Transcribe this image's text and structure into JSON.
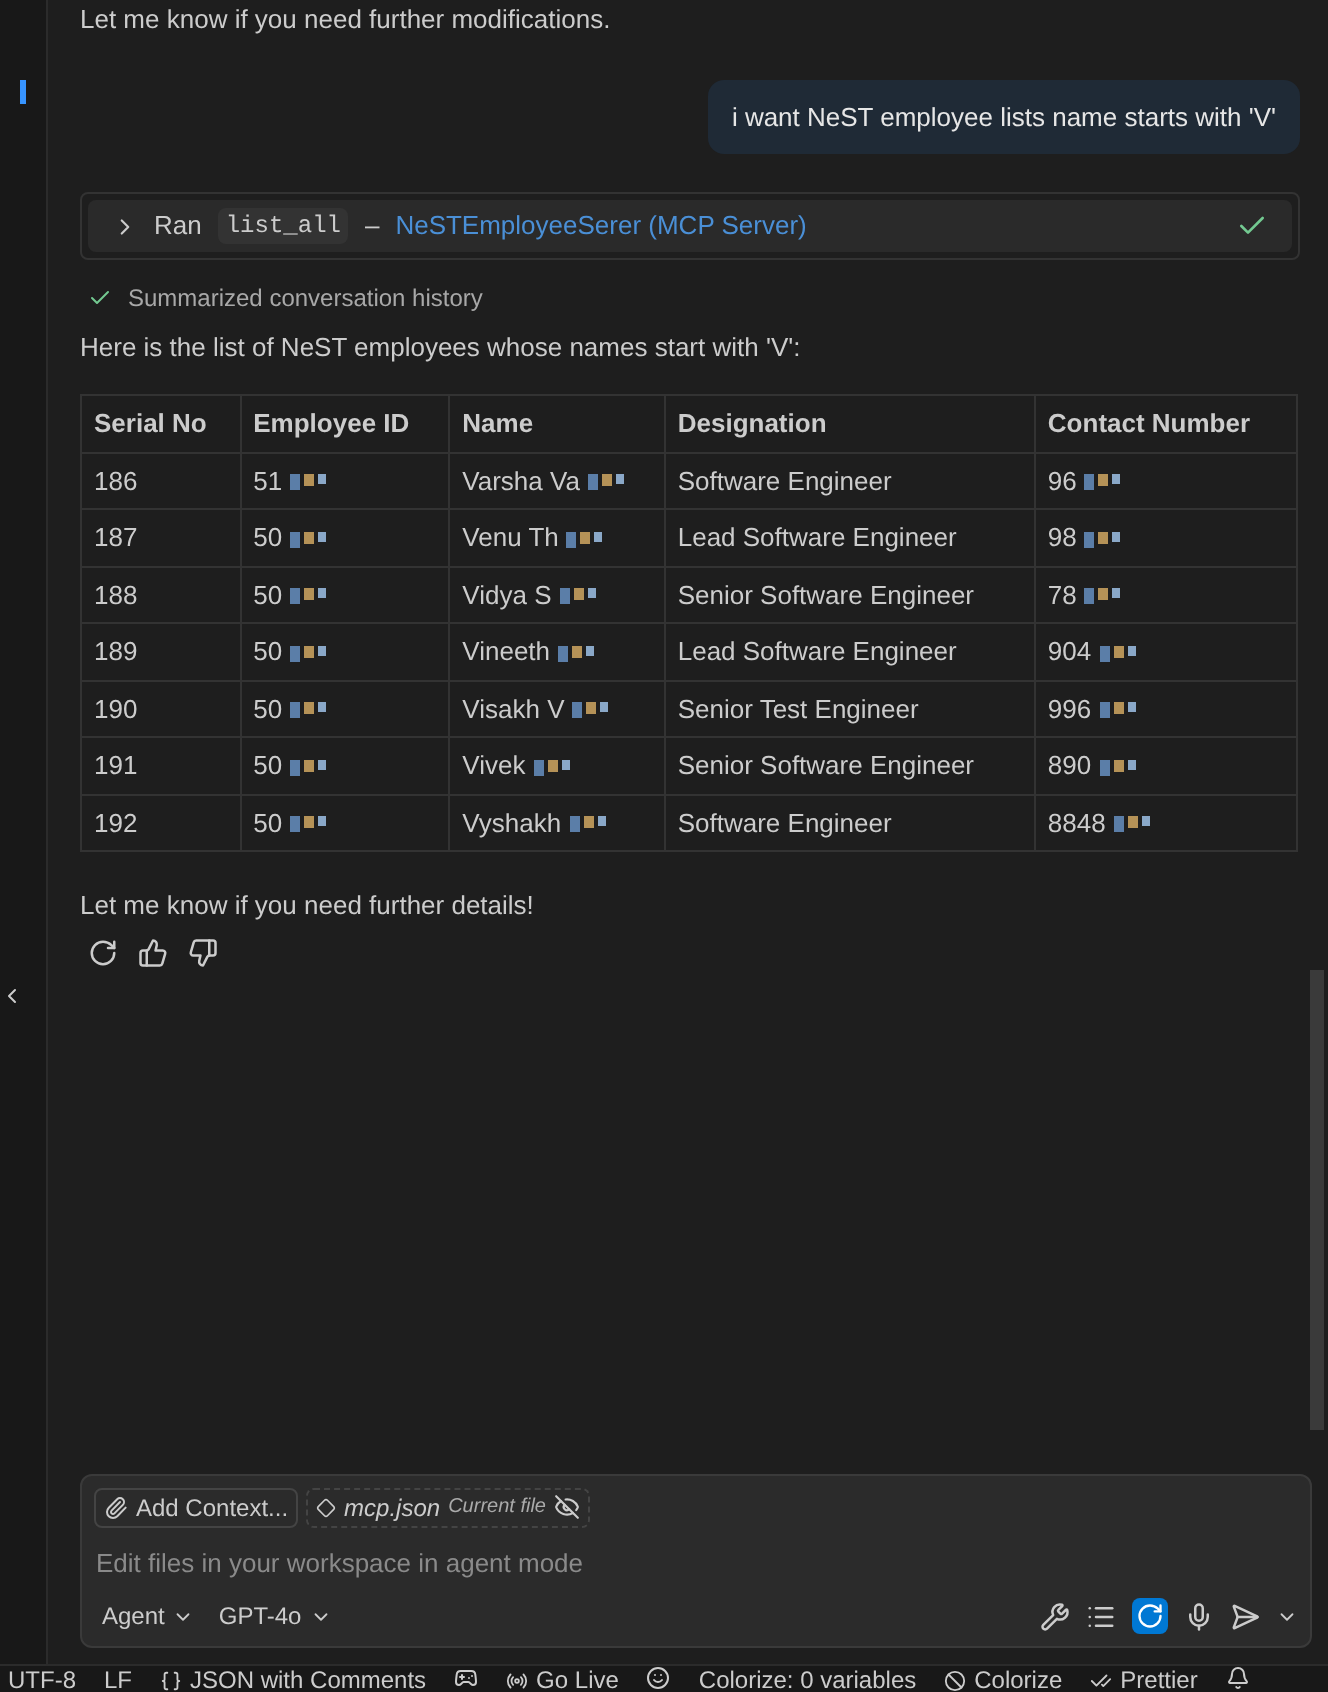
{
  "previous_message": "Let me know if you need further modifications.",
  "user_message": "i want NeST employee lists name starts with 'V'",
  "tool_run": {
    "expanded": false,
    "prefix": "Ran",
    "command": "list_all",
    "separator": "–",
    "server": "NeSTEmployeeSerer (MCP Server)",
    "done": true
  },
  "summary": {
    "done": true,
    "text": "Summarized conversation history"
  },
  "intro": "Here is the list of NeST employees whose names start with 'V':",
  "table": {
    "columns": [
      "Serial No",
      "Employee ID",
      "Name",
      "Designation",
      "Contact Number"
    ],
    "rows": [
      [
        "186",
        "51",
        "Varsha Va",
        "Software Engineer",
        "96"
      ],
      [
        "187",
        "50",
        "Venu Th",
        "Lead Software Engineer",
        "98"
      ],
      [
        "188",
        "50",
        "Vidya S",
        "Senior Software Engineer",
        "78"
      ],
      [
        "189",
        "50",
        "Vineeth",
        "Lead Software Engineer",
        "904"
      ],
      [
        "190",
        "50",
        "Visakh V",
        "Senior Test Engineer",
        "996"
      ],
      [
        "191",
        "50",
        "Vivek",
        "Senior Software Engineer",
        "890"
      ],
      [
        "192",
        "50",
        "Vyshakh",
        "Software Engineer",
        "8848"
      ]
    ]
  },
  "closing": "Let me know if you need further details!",
  "input": {
    "add_context": "Add Context...",
    "file_name": "mcp.json",
    "file_note": "Current file",
    "placeholder": "Edit files in your workspace in agent mode",
    "mode": "Agent",
    "model": "GPT-4o"
  },
  "status_bar": [
    "UTF-8",
    "LF",
    "JSON with Comments",
    "Go Live",
    "Colorize: 0 variables",
    "Colorize",
    "Prettier"
  ]
}
